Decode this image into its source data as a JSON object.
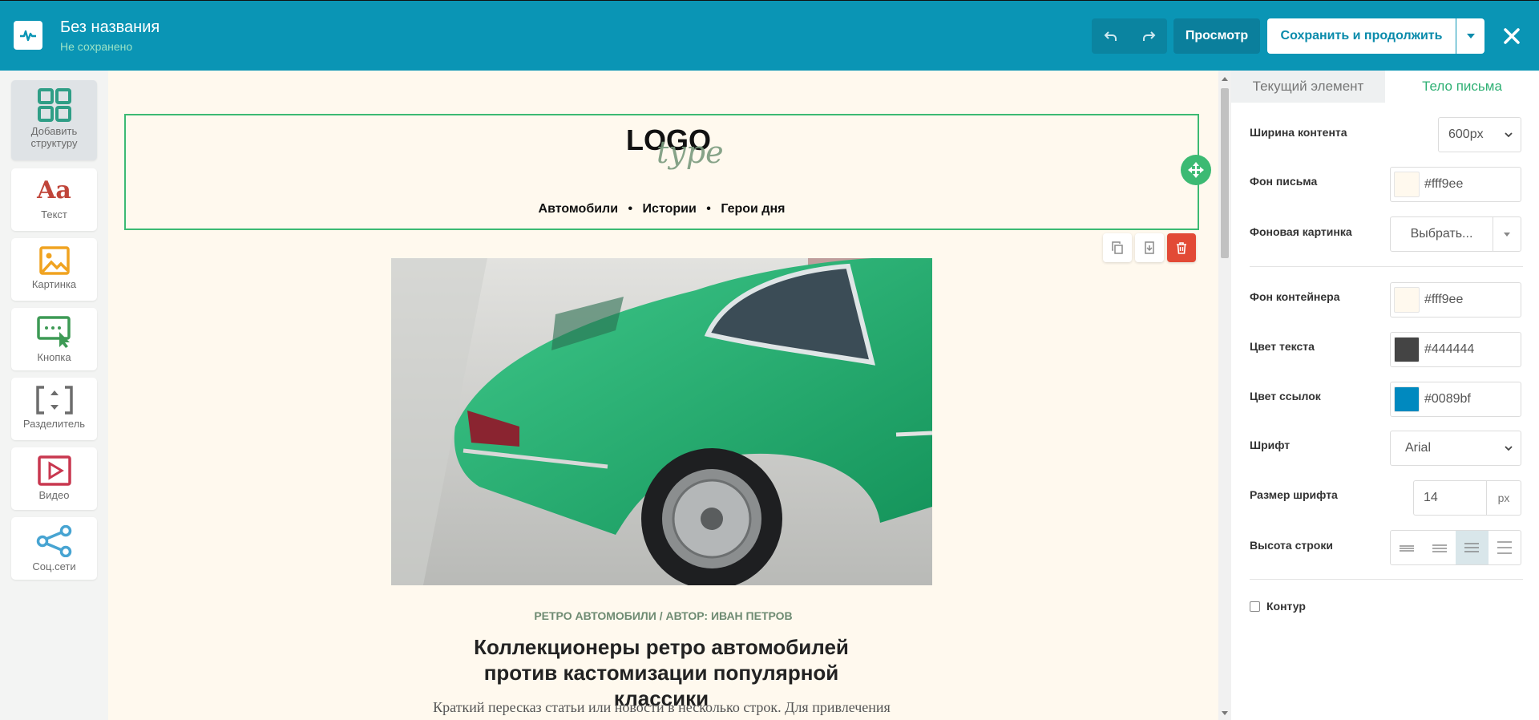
{
  "header": {
    "title": "Без названия",
    "status": "Не сохранено",
    "preview_label": "Просмотр",
    "save_label": "Сохранить и продолжить"
  },
  "sidebar": {
    "items": [
      {
        "label": "Добавить структуру",
        "icon": "structure-grid-icon"
      },
      {
        "label": "Текст",
        "icon": "text-aa-icon"
      },
      {
        "label": "Картинка",
        "icon": "image-icon"
      },
      {
        "label": "Кнопка",
        "icon": "button-cursor-icon"
      },
      {
        "label": "Разделитель",
        "icon": "divider-icon"
      },
      {
        "label": "Видео",
        "icon": "video-play-icon"
      },
      {
        "label": "Соц.сети",
        "icon": "share-icon"
      }
    ]
  },
  "email": {
    "logo_text": "LOGO",
    "logo_script": "type",
    "nav": [
      "Автомобили",
      "Истории",
      "Герои дня"
    ],
    "nav_separator": "•",
    "kicker": "РЕТРО АВТОМОБИЛИ / АВТОР: ИВАН ПЕТРОВ",
    "headline": "Коллекционеры ретро автомобилей против кастомизации популярной классики",
    "lede": "Краткий пересказ статьи или новости в несколько строк. Для привлечения"
  },
  "panel": {
    "tabs": [
      "Текущий элемент",
      "Тело письма"
    ],
    "content_width": {
      "label": "Ширина контента",
      "value": "600px"
    },
    "email_bg": {
      "label": "Фон письма",
      "value": "#fff9ee"
    },
    "bg_image": {
      "label": "Фоновая картинка",
      "button": "Выбрать..."
    },
    "container_bg": {
      "label": "Фон контейнера",
      "value": "#fff9ee"
    },
    "text_color": {
      "label": "Цвет текста",
      "value": "#444444"
    },
    "link_color": {
      "label": "Цвет ссылок",
      "value": "#0089bf"
    },
    "font": {
      "label": "Шрифт",
      "value": "Arial"
    },
    "font_size": {
      "label": "Размер шрифта",
      "value": "14",
      "unit": "px"
    },
    "line_height": {
      "label": "Высота строки",
      "selected_index": 2
    },
    "outline": {
      "label": "Контур",
      "checked": false
    }
  },
  "colors": {
    "brand": "#0a95b5",
    "accent_green": "#3cba73",
    "danger": "#e24a36"
  }
}
